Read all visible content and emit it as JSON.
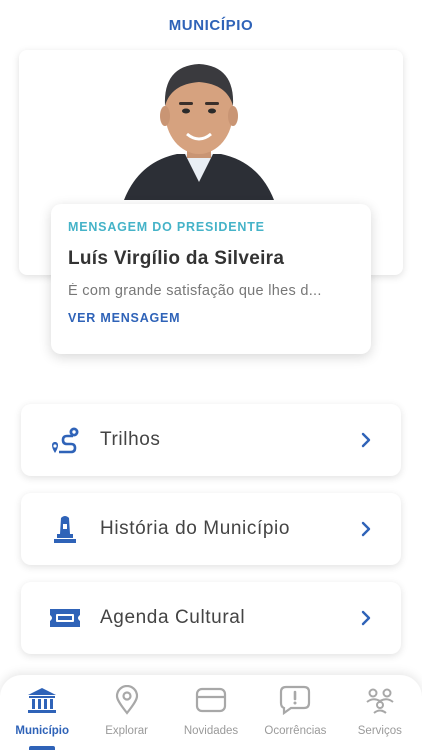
{
  "header": {
    "title": "MUNICÍPIO"
  },
  "message": {
    "kicker": "MENSAGEM DO PRESIDENTE",
    "name": "Luís Virgílio da Silveira",
    "excerpt": "É com grande satisfação que lhes d...",
    "link": "VER MENSAGEM"
  },
  "menu": {
    "items": [
      {
        "label": "Trilhos",
        "icon": "trail-route-icon"
      },
      {
        "label": "História do Município",
        "icon": "monument-icon"
      },
      {
        "label": "Agenda Cultural",
        "icon": "ticket-icon"
      }
    ]
  },
  "tabs": [
    {
      "label": "Município",
      "icon": "town-hall-icon",
      "active": true
    },
    {
      "label": "Explorar",
      "icon": "map-pin-icon"
    },
    {
      "label": "Novidades",
      "icon": "news-card-icon"
    },
    {
      "label": "Ocorrências",
      "icon": "alert-bubble-icon"
    },
    {
      "label": "Serviços",
      "icon": "services-icon"
    }
  ],
  "colors": {
    "accent": "#2f63b8",
    "kicker": "#45b3c8",
    "inactive": "#9a9a9a"
  }
}
